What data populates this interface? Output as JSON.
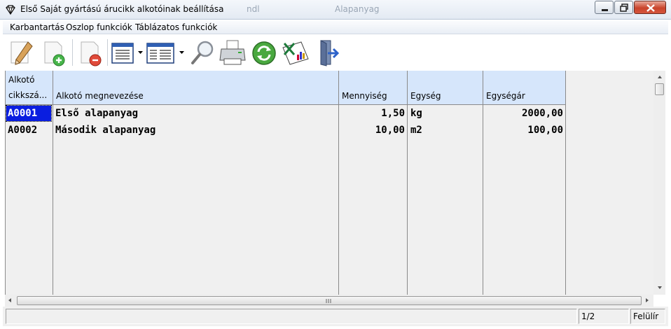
{
  "window": {
    "title": "Első Saját gyártású árucikk alkotóinak beállítása",
    "ghost_left": "ndl",
    "ghost_right": "Alapanyag",
    "buttons": [
      "minimize",
      "maximize",
      "close"
    ]
  },
  "menu": {
    "items": [
      "Karbantartás",
      "Oszlop funkciók",
      "Táblázatos funkciók"
    ]
  },
  "toolbar": {
    "buttons": [
      {
        "icon": "edit-pencil-icon"
      },
      {
        "icon": "add-document-icon"
      },
      {
        "icon": "delete-document-icon"
      },
      {
        "icon": "column-view-icon",
        "dropdown": true
      },
      {
        "icon": "table-view-icon",
        "dropdown": true
      },
      {
        "icon": "search-icon"
      },
      {
        "icon": "printer-icon"
      },
      {
        "icon": "refresh-icon"
      },
      {
        "icon": "excel-export-icon"
      },
      {
        "icon": "exit-door-icon"
      }
    ]
  },
  "table": {
    "columns": [
      {
        "line1": "Alkotó",
        "line2": "cikkszá..."
      },
      {
        "label": "Alkotó megnevezése"
      },
      {
        "label": "Mennyiség"
      },
      {
        "label": "Egység"
      },
      {
        "label": "Egységár"
      }
    ],
    "rows": [
      {
        "code": "A0001",
        "name": "Első alapanyag",
        "qty": "1,50",
        "unit": "kg",
        "price": "2000,00",
        "selected": true
      },
      {
        "code": "A0002",
        "name": "Második alapanyag",
        "qty": "10,00",
        "unit": "m2",
        "price": "100,00",
        "selected": false
      }
    ]
  },
  "statusbar": {
    "record": "1/2",
    "mode": "Felülír"
  },
  "colors": {
    "header_bg": "#d6e6fb",
    "selection": "#0a1ee0",
    "grid_bg": "#f0f0f0"
  }
}
